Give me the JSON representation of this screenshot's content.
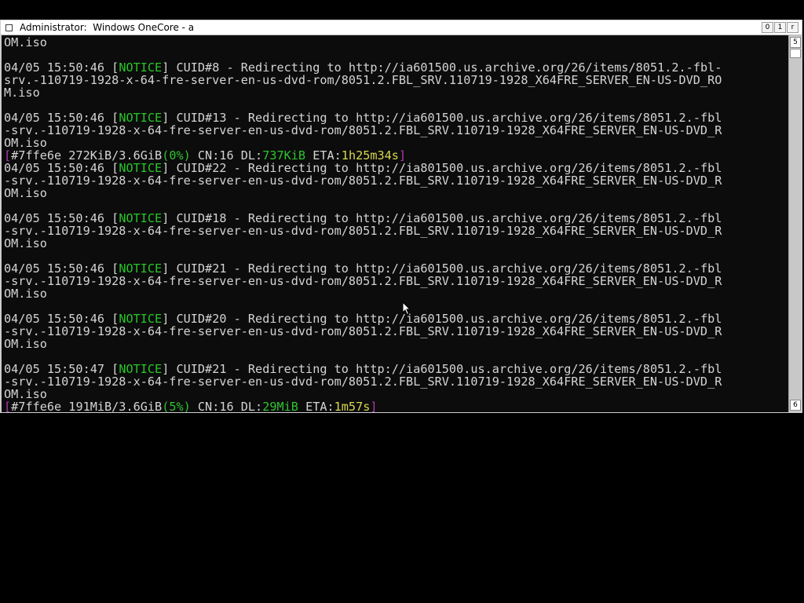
{
  "window": {
    "title": "Administrator:  Windows OneCore - a",
    "buttons": {
      "minimize": "0",
      "maximize": "1",
      "close": "r"
    }
  },
  "scrollbar": {
    "up_glyph": "5",
    "down_glyph": "6"
  },
  "console": {
    "lines": [
      {
        "segments": [
          {
            "text": "OM.iso",
            "style": "default"
          }
        ]
      },
      {
        "segments": []
      },
      {
        "segments": [
          {
            "text": "04/05 15:50:46 [",
            "style": "default"
          },
          {
            "text": "NOTICE",
            "style": "notice"
          },
          {
            "text": "] CUID#8 - Redirecting to http://ia601500.us.archive.org/26/items/8051.2.-fbl-",
            "style": "default"
          }
        ]
      },
      {
        "segments": [
          {
            "text": "srv.-110719-1928-x-64-fre-server-en-us-dvd-rom/8051.2.FBL_SRV.110719-1928_X64FRE_SERVER_EN-US-DVD_RO",
            "style": "default"
          }
        ]
      },
      {
        "segments": [
          {
            "text": "M.iso",
            "style": "default"
          }
        ]
      },
      {
        "segments": []
      },
      {
        "segments": [
          {
            "text": "04/05 15:50:46 [",
            "style": "default"
          },
          {
            "text": "NOTICE",
            "style": "notice"
          },
          {
            "text": "] CUID#13 - Redirecting to http://ia601500.us.archive.org/26/items/8051.2.-fbl",
            "style": "default"
          }
        ]
      },
      {
        "segments": [
          {
            "text": "-srv.-110719-1928-x-64-fre-server-en-us-dvd-rom/8051.2.FBL_SRV.110719-1928_X64FRE_SERVER_EN-US-DVD_R",
            "style": "default"
          }
        ]
      },
      {
        "segments": [
          {
            "text": "OM.iso",
            "style": "default"
          }
        ]
      },
      {
        "segments": [
          {
            "text": "[",
            "style": "bracket"
          },
          {
            "text": "#7ffe6e 272KiB/3.6GiB",
            "style": "default"
          },
          {
            "text": "(0%)",
            "style": "green"
          },
          {
            "text": " CN:16 DL:",
            "style": "default"
          },
          {
            "text": "737KiB",
            "style": "green"
          },
          {
            "text": " ETA:",
            "style": "default"
          },
          {
            "text": "1h25m34s",
            "style": "yellow"
          },
          {
            "text": "]",
            "style": "bracket"
          }
        ]
      },
      {
        "segments": [
          {
            "text": "04/05 15:50:46 [",
            "style": "default"
          },
          {
            "text": "NOTICE",
            "style": "notice"
          },
          {
            "text": "] CUID#22 - Redirecting to http://ia801500.us.archive.org/26/items/8051.2.-fbl",
            "style": "default"
          }
        ]
      },
      {
        "segments": [
          {
            "text": "-srv.-110719-1928-x-64-fre-server-en-us-dvd-rom/8051.2.FBL_SRV.110719-1928_X64FRE_SERVER_EN-US-DVD_R",
            "style": "default"
          }
        ]
      },
      {
        "segments": [
          {
            "text": "OM.iso",
            "style": "default"
          }
        ]
      },
      {
        "segments": []
      },
      {
        "segments": [
          {
            "text": "04/05 15:50:46 [",
            "style": "default"
          },
          {
            "text": "NOTICE",
            "style": "notice"
          },
          {
            "text": "] CUID#18 - Redirecting to http://ia601500.us.archive.org/26/items/8051.2.-fbl",
            "style": "default"
          }
        ]
      },
      {
        "segments": [
          {
            "text": "-srv.-110719-1928-x-64-fre-server-en-us-dvd-rom/8051.2.FBL_SRV.110719-1928_X64FRE_SERVER_EN-US-DVD_R",
            "style": "default"
          }
        ]
      },
      {
        "segments": [
          {
            "text": "OM.iso",
            "style": "default"
          }
        ]
      },
      {
        "segments": []
      },
      {
        "segments": [
          {
            "text": "04/05 15:50:46 [",
            "style": "default"
          },
          {
            "text": "NOTICE",
            "style": "notice"
          },
          {
            "text": "] CUID#21 - Redirecting to http://ia601500.us.archive.org/26/items/8051.2.-fbl",
            "style": "default"
          }
        ]
      },
      {
        "segments": [
          {
            "text": "-srv.-110719-1928-x-64-fre-server-en-us-dvd-rom/8051.2.FBL_SRV.110719-1928_X64FRE_SERVER_EN-US-DVD_R",
            "style": "default"
          }
        ]
      },
      {
        "segments": [
          {
            "text": "OM.iso",
            "style": "default"
          }
        ]
      },
      {
        "segments": []
      },
      {
        "segments": [
          {
            "text": "04/05 15:50:46 [",
            "style": "default"
          },
          {
            "text": "NOTICE",
            "style": "notice"
          },
          {
            "text": "] CUID#20 - Redirecting to http://ia601500.us.archive.org/26/items/8051.2.-fbl",
            "style": "default"
          }
        ]
      },
      {
        "segments": [
          {
            "text": "-srv.-110719-1928-x-64-fre-server-en-us-dvd-rom/8051.2.FBL_SRV.110719-1928_X64FRE_SERVER_EN-US-DVD_R",
            "style": "default"
          }
        ]
      },
      {
        "segments": [
          {
            "text": "OM.iso",
            "style": "default"
          }
        ]
      },
      {
        "segments": []
      },
      {
        "segments": [
          {
            "text": "04/05 15:50:47 [",
            "style": "default"
          },
          {
            "text": "NOTICE",
            "style": "notice"
          },
          {
            "text": "] CUID#21 - Redirecting to http://ia601500.us.archive.org/26/items/8051.2.-fbl",
            "style": "default"
          }
        ]
      },
      {
        "segments": [
          {
            "text": "-srv.-110719-1928-x-64-fre-server-en-us-dvd-rom/8051.2.FBL_SRV.110719-1928_X64FRE_SERVER_EN-US-DVD_R",
            "style": "default"
          }
        ]
      },
      {
        "segments": [
          {
            "text": "OM.iso",
            "style": "default"
          }
        ]
      },
      {
        "segments": [
          {
            "text": "[",
            "style": "bracket"
          },
          {
            "text": "#7ffe6e 191MiB/3.6GiB",
            "style": "default"
          },
          {
            "text": "(5%)",
            "style": "green"
          },
          {
            "text": " CN:16 DL:",
            "style": "default"
          },
          {
            "text": "29MiB",
            "style": "green"
          },
          {
            "text": " ETA:",
            "style": "default"
          },
          {
            "text": "1m57s",
            "style": "yellow"
          },
          {
            "text": "]",
            "style": "bracket"
          }
        ]
      }
    ]
  }
}
